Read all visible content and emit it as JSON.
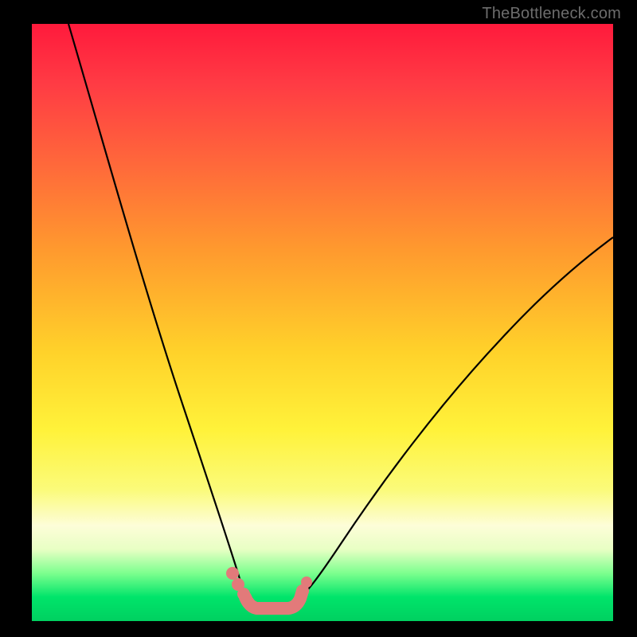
{
  "watermark": "TheBottleneck.com",
  "colors": {
    "background": "#000000",
    "curve": "#000000",
    "highlight": "#e27a7a"
  },
  "chart_data": {
    "type": "line",
    "title": "",
    "xlabel": "",
    "ylabel": "",
    "xlim": [
      0,
      100
    ],
    "ylim": [
      0,
      100
    ],
    "grid": false,
    "legend": false,
    "background_gradient": [
      "#ff1a3c",
      "#ff6a3a",
      "#ffd22a",
      "#fff23a",
      "#fdfdd8",
      "#7cff8e",
      "#00d060"
    ],
    "series": [
      {
        "name": "left-curve",
        "x": [
          6,
          10,
          14,
          18,
          22,
          26,
          29,
          31.5,
          33.5,
          35.5,
          37
        ],
        "values": [
          100,
          82,
          67,
          53,
          40,
          28,
          17,
          10,
          6.5,
          4,
          3
        ]
      },
      {
        "name": "right-curve",
        "x": [
          45,
          48,
          52,
          58,
          64,
          72,
          80,
          88,
          96,
          100
        ],
        "values": [
          3,
          5,
          10,
          18,
          26,
          35,
          44,
          52,
          59,
          63
        ]
      },
      {
        "name": "bottleneck-flat-highlight",
        "x": [
          35.5,
          38,
          41,
          44,
          45.5
        ],
        "values": [
          3.5,
          2.5,
          2.3,
          2.6,
          3.8
        ]
      }
    ],
    "annotations": [
      {
        "type": "watermark",
        "text": "TheBottleneck.com",
        "position": "top-right"
      }
    ]
  }
}
